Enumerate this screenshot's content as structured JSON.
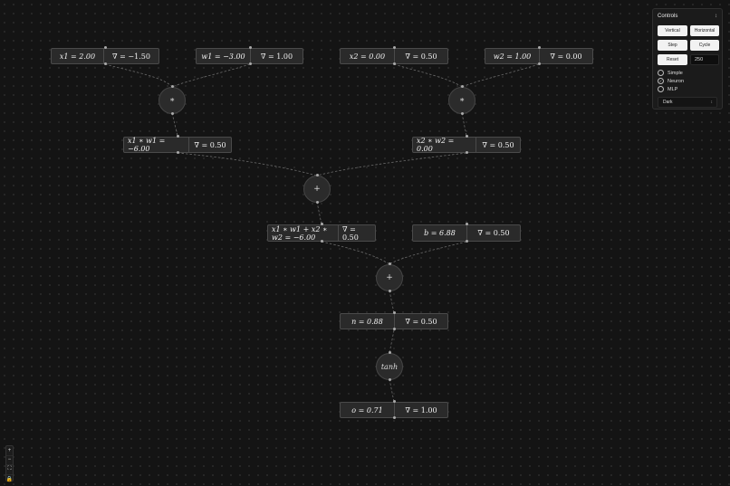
{
  "graph": {
    "nodes": [
      {
        "id": "x1",
        "value_text": "x1 = 2.00",
        "grad_text": "∇ = −1.50"
      },
      {
        "id": "w1",
        "value_text": "w1 = −3.00",
        "grad_text": "∇ = 1.00"
      },
      {
        "id": "x2",
        "value_text": "x2 = 0.00",
        "grad_text": "∇ = 0.50"
      },
      {
        "id": "w2",
        "value_text": "w2 = 1.00",
        "grad_text": "∇ = 0.00"
      },
      {
        "id": "x1w1",
        "value_text": "x1 ∗ w1 = −6.00",
        "grad_text": "∇ = 0.50"
      },
      {
        "id": "x2w2",
        "value_text": "x2 ∗ w2 = 0.00",
        "grad_text": "∇ = 0.50"
      },
      {
        "id": "sum",
        "value_text": "x1 ∗ w1 + x2 ∗ w2 = −6.00",
        "grad_text": "∇ = 0.50"
      },
      {
        "id": "b",
        "value_text": "b = 6.88",
        "grad_text": "∇ = 0.50"
      },
      {
        "id": "n",
        "value_text": "n = 0.88",
        "grad_text": "∇ = 0.50"
      },
      {
        "id": "o",
        "value_text": "o = 0.71",
        "grad_text": "∇ = 1.00"
      }
    ],
    "ops": [
      {
        "id": "mul1",
        "symbol": "∗"
      },
      {
        "id": "mul2",
        "symbol": "∗"
      },
      {
        "id": "add1",
        "symbol": "+"
      },
      {
        "id": "add2",
        "symbol": "+"
      },
      {
        "id": "tanh",
        "symbol": "tanh"
      }
    ]
  },
  "controls": {
    "title": "Controls",
    "buttons": {
      "vertical": "Vertical",
      "horizontal": "Horizontal",
      "step": "Step",
      "cycle": "Cycle",
      "reset": "Reset"
    },
    "steps_value": "250",
    "modes": [
      {
        "label": "Simple",
        "checked": false
      },
      {
        "label": "Neuron",
        "checked": true
      },
      {
        "label": "MLP",
        "checked": false
      }
    ],
    "theme": "Dark"
  },
  "zoom": {
    "in": "+",
    "out": "−",
    "fit": "⛶",
    "lock": "🔒"
  },
  "colors": {
    "background": "#141414",
    "node_fill": "#2a2a2a",
    "edge": "#666666",
    "accent": "#f2f2f2"
  }
}
